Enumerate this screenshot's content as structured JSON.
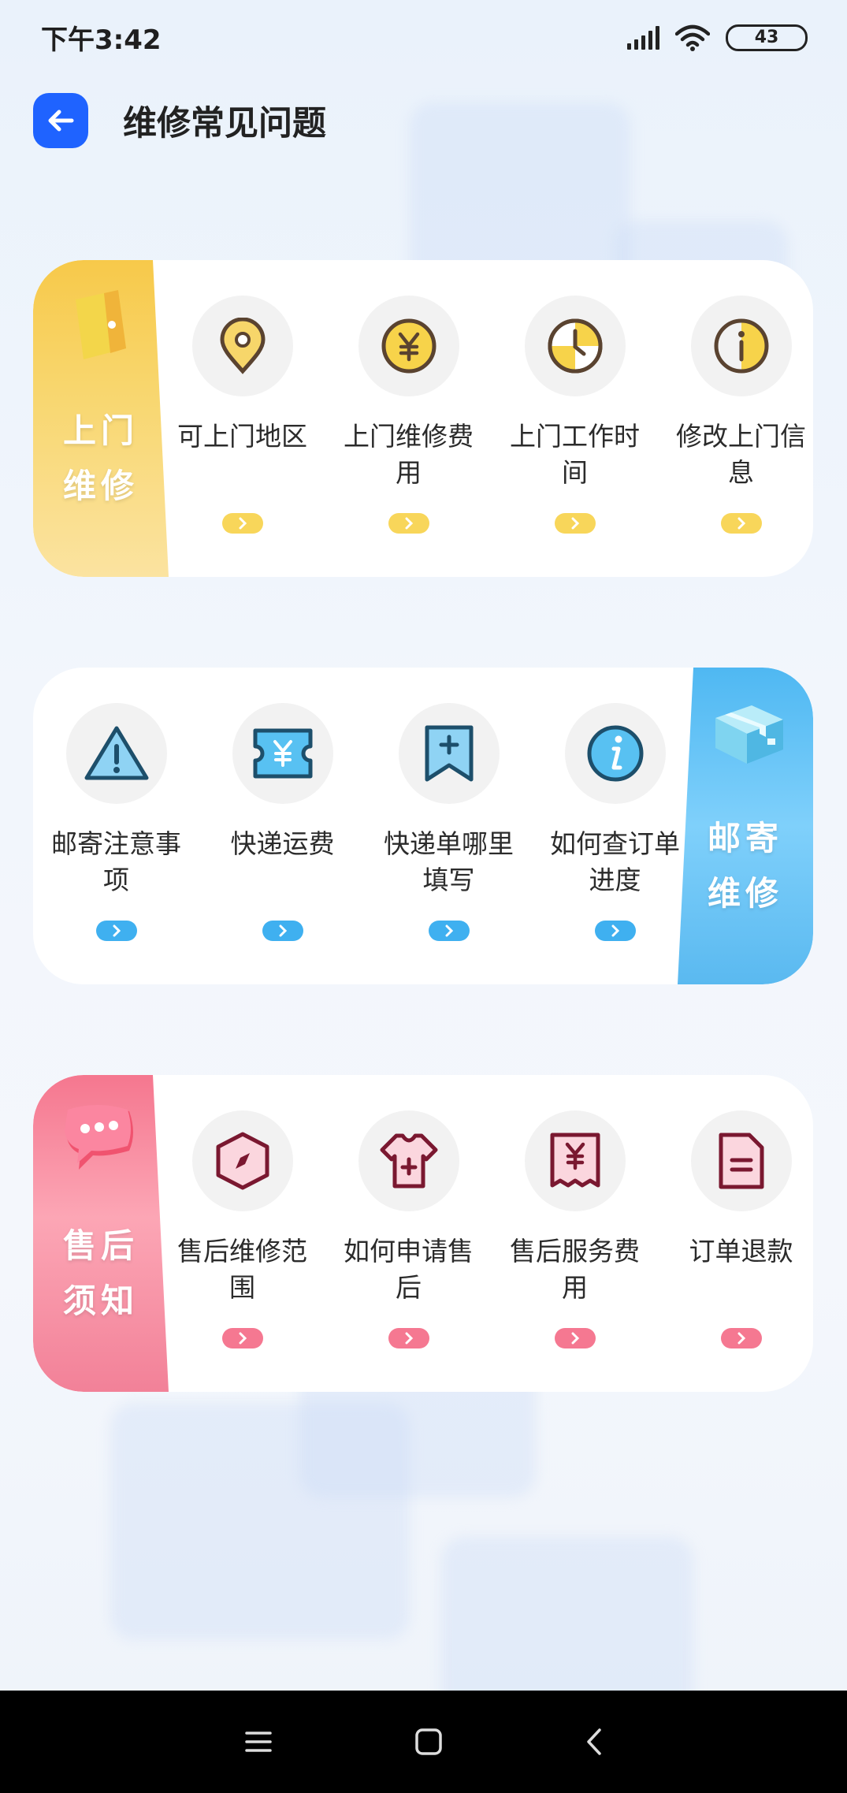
{
  "status_bar": {
    "time": "下午3:42",
    "battery": "43",
    "icons": [
      "signal-icon",
      "wifi-icon",
      "battery-icon"
    ]
  },
  "header": {
    "title": "维修常见问题",
    "back_icon": "arrow-left-icon"
  },
  "sections": [
    {
      "badge": [
        "上门",
        "维修"
      ],
      "color": "#f8d65a",
      "items": [
        {
          "label": "可上门地区",
          "icon": "location-pin-icon"
        },
        {
          "label": "上门维修费用",
          "icon": "yuan-coin-icon"
        },
        {
          "label": "上门工作时间",
          "icon": "clock-icon"
        },
        {
          "label": "修改上门信息",
          "icon": "info-icon"
        }
      ]
    },
    {
      "badge": [
        "邮寄",
        "维修"
      ],
      "color": "#3fb0f0",
      "items": [
        {
          "label": "邮寄注意事项",
          "icon": "warning-triangle-icon"
        },
        {
          "label": "快递运费",
          "icon": "yuan-ticket-icon"
        },
        {
          "label": "快递单哪里填写",
          "icon": "bookmark-plus-icon"
        },
        {
          "label": "如何查订单进度",
          "icon": "info-circle-icon"
        }
      ]
    },
    {
      "badge": [
        "售后",
        "须知"
      ],
      "color": "#f57891",
      "items": [
        {
          "label": "售后维修范围",
          "icon": "compass-hexagon-icon"
        },
        {
          "label": "如何申请售后",
          "icon": "shirt-icon"
        },
        {
          "label": "售后服务费用",
          "icon": "yuan-receipt-icon"
        },
        {
          "label": "订单退款",
          "icon": "document-icon"
        }
      ]
    }
  ],
  "nav_bar": {
    "icons": [
      "menu-icon",
      "home-square-icon",
      "back-chevron-icon"
    ]
  }
}
